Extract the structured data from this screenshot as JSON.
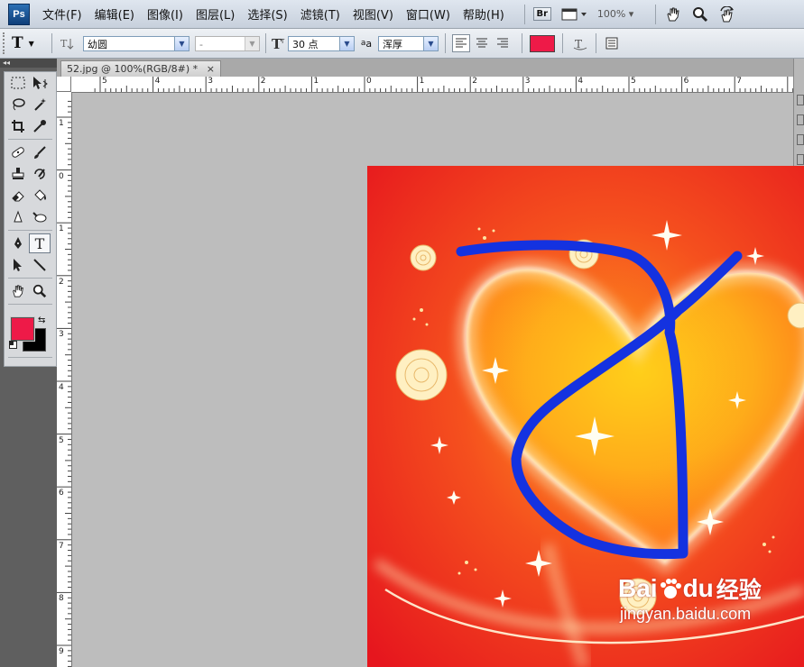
{
  "app": {
    "logo_text": "Ps"
  },
  "menu": {
    "items": [
      "文件(F)",
      "编辑(E)",
      "图像(I)",
      "图层(L)",
      "选择(S)",
      "滤镜(T)",
      "视图(V)",
      "窗口(W)",
      "帮助(H)"
    ],
    "bridge_label": "Br",
    "zoom": "100%"
  },
  "options": {
    "font_family": "幼圆",
    "font_style": "-",
    "font_size": "30 点",
    "aa_label": "a",
    "anti_alias": "浑厚",
    "text_color": "#ee1a48"
  },
  "document": {
    "tab_title": "52.jpg @ 100%(RGB/8#) *",
    "close_glyph": "×"
  },
  "rulers": {
    "h_labels": [
      "5",
      "4",
      "3",
      "2",
      "1",
      "0",
      "1",
      "2",
      "3",
      "4",
      "5",
      "6",
      "7"
    ],
    "v_labels": [
      "1",
      "0",
      "1",
      "2",
      "3",
      "4",
      "5",
      "6",
      "7",
      "8",
      "9"
    ]
  },
  "colors": {
    "foreground": "#ee1a48",
    "background": "#000000",
    "stroke": "#1432e0"
  },
  "watermark": {
    "brand_bai": "Bai",
    "brand_du": "du",
    "brand_cn": "经验",
    "url": "jingyan.baidu.com"
  }
}
